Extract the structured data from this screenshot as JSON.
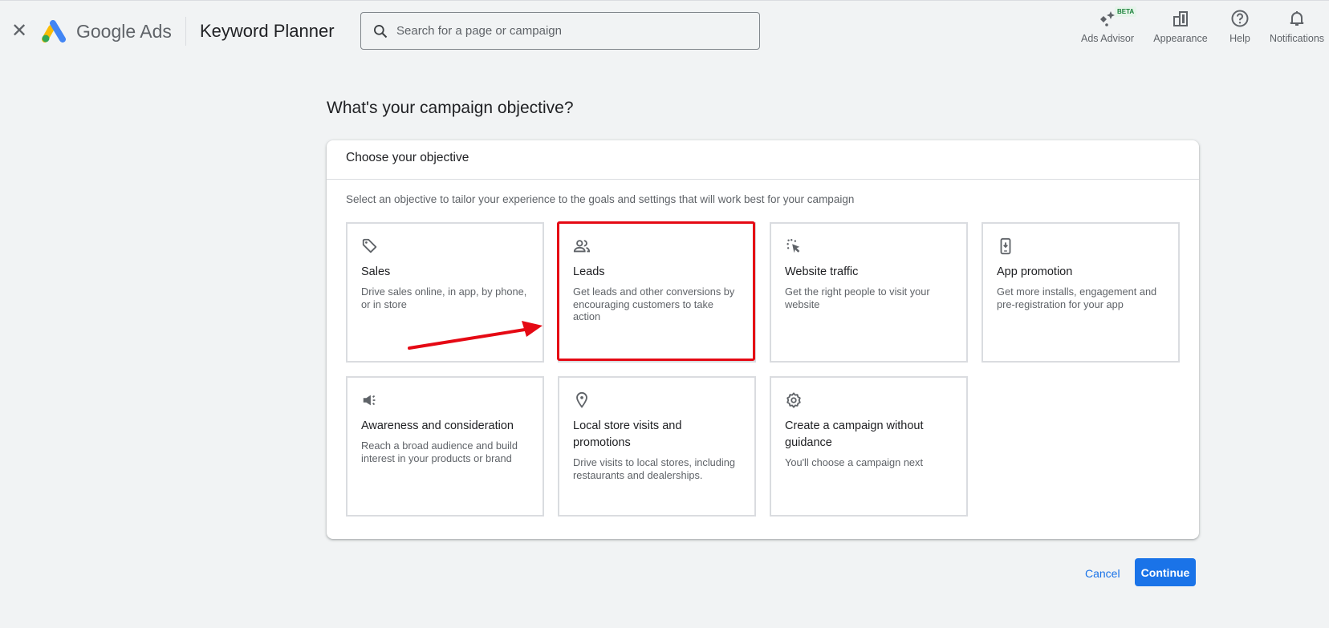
{
  "header": {
    "close_icon": "close-icon",
    "brand": "Google Ads",
    "product": "Keyword Planner",
    "search_placeholder": "Search for a page or campaign",
    "tools": [
      {
        "label": "Ads Advisor",
        "icon": "sparkle-icon",
        "badge": "BETA"
      },
      {
        "label": "Appearance",
        "icon": "appearance-icon"
      },
      {
        "label": "Help",
        "icon": "help-icon"
      },
      {
        "label": "Notifications",
        "icon": "bell-icon"
      }
    ]
  },
  "main": {
    "title": "What's your campaign objective?",
    "panel_title": "Choose your objective",
    "description": "Select an objective to tailor your experience to the goals and settings that will work best for your campaign",
    "objectives": [
      {
        "title": "Sales",
        "desc": "Drive sales online, in app, by phone, or in store",
        "icon": "tag-icon"
      },
      {
        "title": "Leads",
        "desc": "Get leads and other conversions by encouraging customers to take action",
        "icon": "people-icon",
        "highlighted": true
      },
      {
        "title": "Website traffic",
        "desc": "Get the right people to visit your website",
        "icon": "cursor-click-icon"
      },
      {
        "title": "App promotion",
        "desc": "Get more installs, engagement and pre-registration for your app",
        "icon": "phone-download-icon"
      },
      {
        "title": "Awareness and consideration",
        "desc": "Reach a broad audience and build interest in your products or brand",
        "icon": "megaphone-icon"
      },
      {
        "title": "Local store visits and promotions",
        "desc": "Drive visits to local stores, including restaurants and dealerships.",
        "icon": "location-pin-icon"
      },
      {
        "title": "Create a campaign without guidance",
        "desc": "You'll choose a campaign next",
        "icon": "gear-icon"
      }
    ]
  },
  "footer": {
    "cancel": "Cancel",
    "continue": "Continue"
  },
  "colors": {
    "accent": "#1a73e8",
    "annotation": "#e50914",
    "background": "#f1f3f4"
  }
}
